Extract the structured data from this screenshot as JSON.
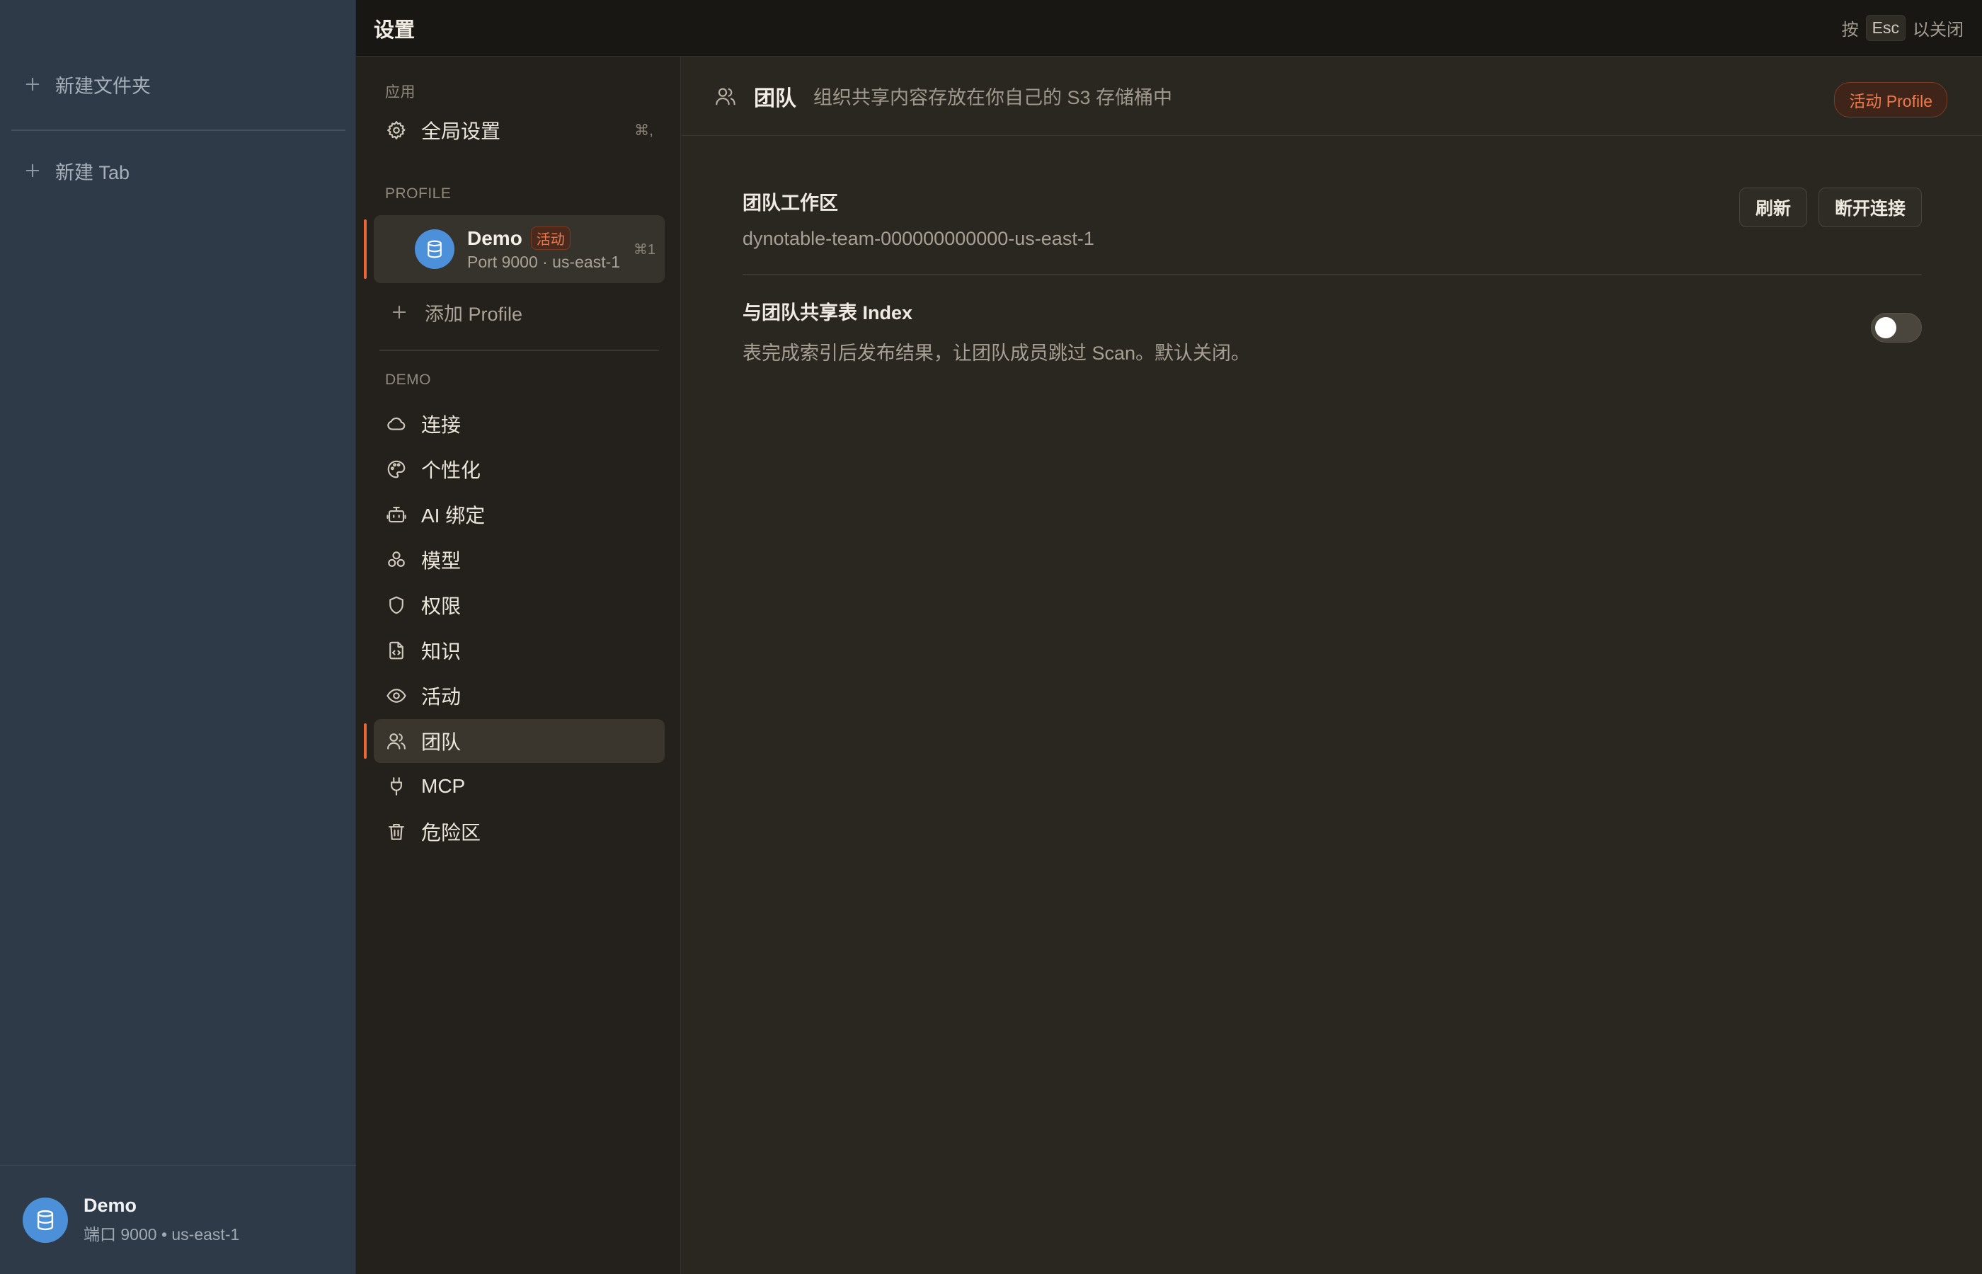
{
  "app_sidebar": {
    "new_folder_label": "新建文件夹",
    "new_tab_label": "新建 Tab",
    "footer": {
      "name": "Demo",
      "subtitle": "端口 9000 • us-east-1"
    }
  },
  "header": {
    "title": "设置",
    "esc_prefix": "按",
    "esc_key": "Esc",
    "esc_suffix": "以关闭"
  },
  "nav": {
    "app_section": "应用",
    "global_settings": {
      "label": "全局设置",
      "shortcut": "⌘,",
      "icon": "gear-icon"
    },
    "profile_section": "PROFILE",
    "profile": {
      "name": "Demo",
      "badge": "活动",
      "subtitle": "Port 9000 · us-east-1",
      "shortcut": "⌘1",
      "icon": "database-icon"
    },
    "add_profile": "添加 Profile",
    "demo_section": "DEMO",
    "items": [
      {
        "label": "连接",
        "icon": "cloud-icon"
      },
      {
        "label": "个性化",
        "icon": "palette-icon"
      },
      {
        "label": "AI 绑定",
        "icon": "bot-icon"
      },
      {
        "label": "模型",
        "icon": "boxes-icon"
      },
      {
        "label": "权限",
        "icon": "shield-icon"
      },
      {
        "label": "知识",
        "icon": "file-code-icon"
      },
      {
        "label": "活动",
        "icon": "eye-icon"
      },
      {
        "label": "团队",
        "icon": "users-icon",
        "active": true
      },
      {
        "label": "MCP",
        "icon": "plug-icon"
      },
      {
        "label": "危险区",
        "icon": "trash-icon"
      }
    ]
  },
  "main": {
    "title": "团队",
    "description": "组织共享内容存放在你自己的 S3 存储桶中",
    "badge": "活动 Profile",
    "workspace": {
      "title": "团队工作区",
      "value": "dynotable-team-000000000000-us-east-1",
      "refresh_label": "刷新",
      "disconnect_label": "断开连接"
    },
    "share_index": {
      "title": "与团队共享表 Index",
      "description": "表完成索引后发布结果，让团队成员跳过 Scan。默认关闭。",
      "enabled": false
    }
  },
  "colors": {
    "accent": "#e8683a",
    "avatar": "#4b90d9",
    "app_sidebar_bg": "#2e3a47",
    "nav_bg": "#24211c",
    "main_bg": "#2a2620"
  }
}
